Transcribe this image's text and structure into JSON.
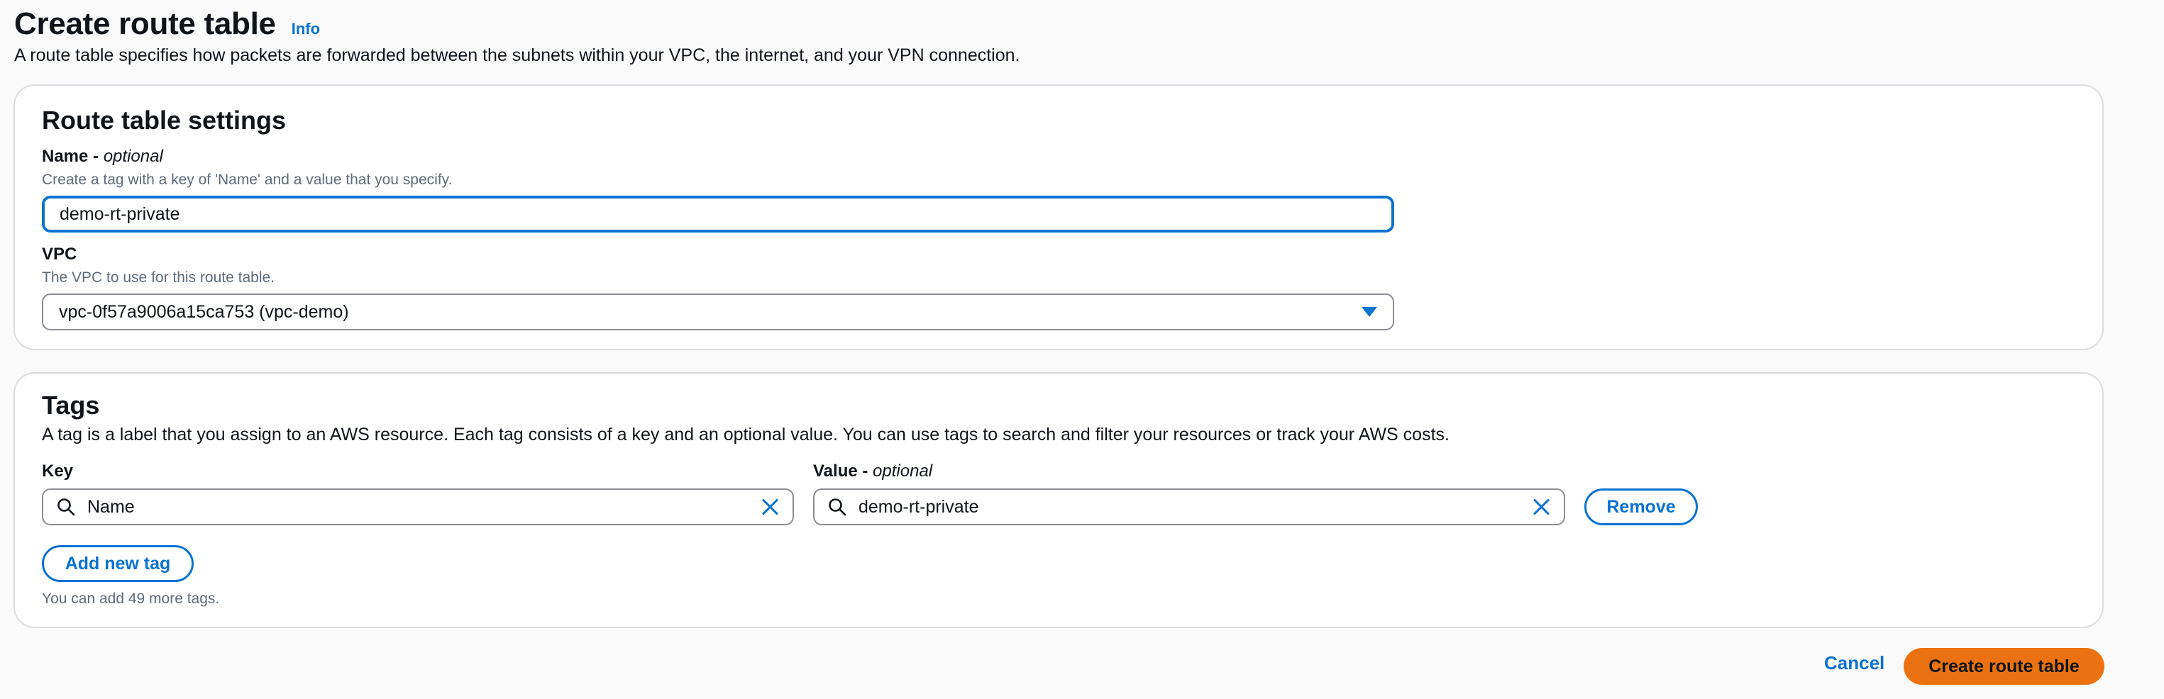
{
  "header": {
    "title": "Create route table",
    "info_link": "Info",
    "description": "A route table specifies how packets are forwarded between the subnets within your VPC, the internet, and your VPN connection."
  },
  "settings": {
    "title": "Route table settings",
    "name_label": "Name - ",
    "name_optional": "optional",
    "name_hint": "Create a tag with a key of 'Name' and a value that you specify.",
    "name_value": "demo-rt-private",
    "vpc_label": "VPC",
    "vpc_hint": "The VPC to use for this route table.",
    "vpc_value": "vpc-0f57a9006a15ca753 (vpc-demo)"
  },
  "tags": {
    "title": "Tags",
    "description": "A tag is a label that you assign to an AWS resource. Each tag consists of a key and an optional value. You can use tags to search and filter your resources or track your AWS costs.",
    "key_label": "Key",
    "value_label": "Value - ",
    "value_optional": "optional",
    "rows": [
      {
        "key": "Name",
        "value": "demo-rt-private",
        "remove_label": "Remove"
      }
    ],
    "add_button": "Add new tag",
    "limit_text": "You can add 49 more tags."
  },
  "footer": {
    "cancel": "Cancel",
    "submit": "Create route table"
  },
  "icons": {
    "search": "search-icon",
    "clear": "close-icon",
    "dropdown": "caret-down-icon"
  },
  "colors": {
    "accent": "#0972d3",
    "primary_button": "#ec7211",
    "panel_border": "#dadde0",
    "hint_text": "#5f6b7a"
  }
}
